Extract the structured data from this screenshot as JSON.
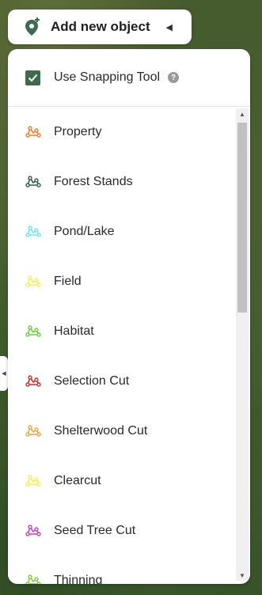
{
  "header_button": {
    "label": "Add new object",
    "icon": "map-pin-plus-icon",
    "caret_icon": "caret-left-icon"
  },
  "snapping": {
    "label": "Use Snapping Tool",
    "checked": true,
    "help_icon": "help-circle-icon",
    "help_glyph": "?"
  },
  "object_types": [
    {
      "label": "Property",
      "color": "#f07d2b",
      "icon": "polygon-icon"
    },
    {
      "label": "Forest Stands",
      "color": "#2f5e44",
      "icon": "polygon-icon"
    },
    {
      "label": "Pond/Lake",
      "color": "#6ee6f0",
      "icon": "polygon-icon"
    },
    {
      "label": "Field",
      "color": "#f3ef5a",
      "icon": "polygon-icon"
    },
    {
      "label": "Habitat",
      "color": "#6ecf3e",
      "icon": "polygon-icon"
    },
    {
      "label": "Selection Cut",
      "color": "#c9302c",
      "icon": "polygon-icon"
    },
    {
      "label": "Shelterwood Cut",
      "color": "#f0a43c",
      "icon": "polygon-icon"
    },
    {
      "label": "Clearcut",
      "color": "#f5ef4e",
      "icon": "polygon-icon"
    },
    {
      "label": "Seed Tree Cut",
      "color": "#c93fc9",
      "icon": "polygon-icon"
    },
    {
      "label": "Thinning",
      "color": "#7fd13a",
      "icon": "polygon-icon"
    }
  ],
  "theme": {
    "checkbox_color": "#3e6a4f",
    "pin_color": "#3e6a4f"
  }
}
